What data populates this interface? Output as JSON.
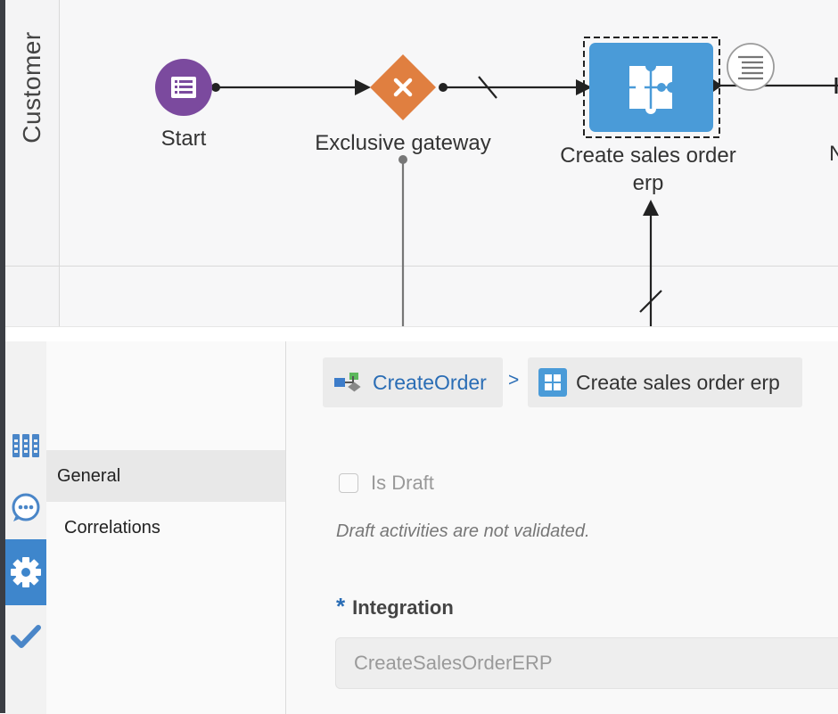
{
  "canvas": {
    "lane_title": "Customer",
    "nodes": {
      "start_label": "Start",
      "gateway_label": "Exclusive gateway",
      "task_label": "Create sales order erp",
      "cut_label": "N"
    }
  },
  "rail": {
    "items": [
      "grid-icon",
      "chat-icon",
      "gear-icon",
      "check-icon"
    ],
    "active": "gear-icon",
    "accent": "#3e86cc"
  },
  "nav": {
    "items": [
      {
        "label": "General",
        "selected": true
      },
      {
        "label": "Correlations",
        "selected": false
      }
    ]
  },
  "breadcrumb": {
    "process": "CreateOrder",
    "separator": ">",
    "activity": "Create sales order erp"
  },
  "form": {
    "draft_label": "Is Draft",
    "draft_checked": false,
    "draft_note": "Draft activities are not validated.",
    "integration_required_marker": "*",
    "integration_label": "Integration",
    "integration_value": "CreateSalesOrderERP"
  },
  "colors": {
    "start_event": "#7b4a9e",
    "gateway": "#e07f40",
    "service_task": "#4a9bd8",
    "link": "#2a6db5"
  }
}
